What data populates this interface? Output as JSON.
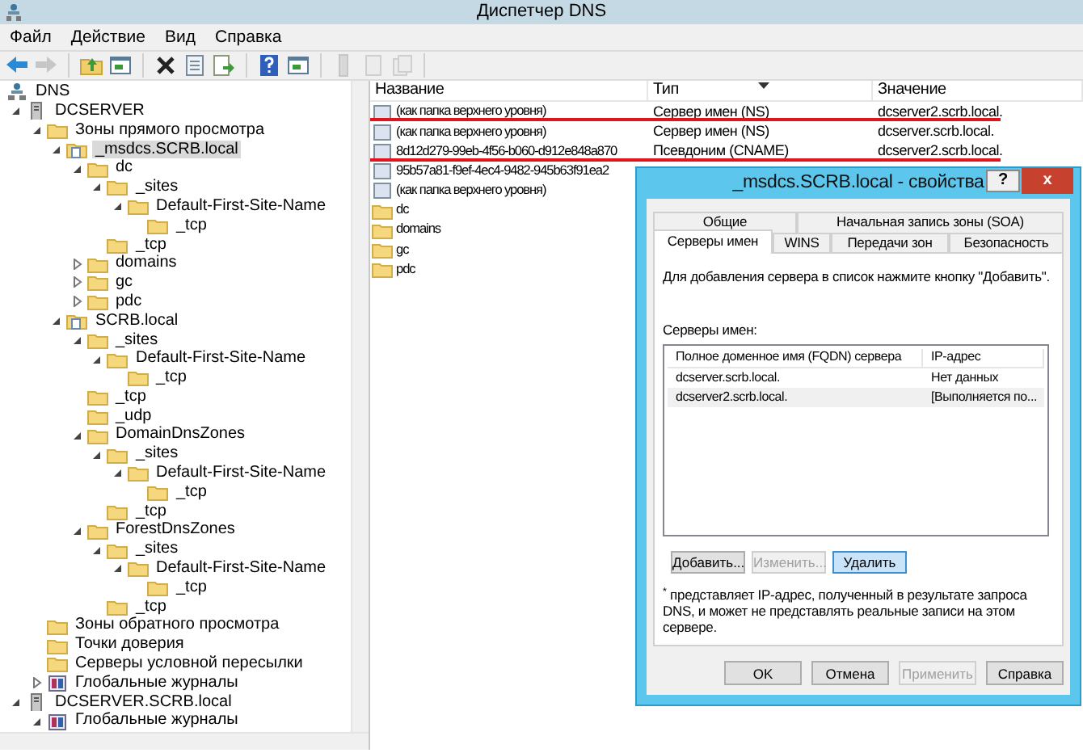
{
  "window": {
    "title": "Диспетчер DNS"
  },
  "menu": [
    "Файл",
    "Действие",
    "Вид",
    "Справка"
  ],
  "toolbar_groups": [
    {
      "buttons": [
        {
          "kind": "back",
          "disabled": false
        },
        {
          "kind": "forward",
          "disabled": true
        }
      ]
    },
    {
      "buttons": [
        {
          "kind": "up",
          "disabled": false
        },
        {
          "kind": "console",
          "disabled": false
        }
      ]
    },
    {
      "buttons": [
        {
          "kind": "delete",
          "disabled": false
        },
        {
          "kind": "properties",
          "disabled": false
        },
        {
          "kind": "export",
          "disabled": false
        }
      ]
    },
    {
      "buttons": [
        {
          "kind": "help",
          "disabled": false
        },
        {
          "kind": "console",
          "disabled": false
        }
      ]
    },
    {
      "buttons": [
        {
          "kind": "server",
          "disabled": true
        },
        {
          "kind": "page",
          "disabled": true
        },
        {
          "kind": "pages",
          "disabled": true
        }
      ]
    }
  ],
  "tree": [
    {
      "label": "DNS",
      "kind": "network",
      "selected": false,
      "children": [
        {
          "label": "DCSERVER",
          "kind": "server",
          "expanded": true,
          "selected": false,
          "children": [
            {
              "label": "Зоны прямого просмотра",
              "kind": "folder",
              "expanded": true,
              "selected": false,
              "children": [
                {
                  "label": "_msdcs.SCRB.local",
                  "kind": "zone",
                  "expanded": true,
                  "selected": true,
                  "children": [
                    {
                      "label": "dc",
                      "kind": "folder",
                      "expanded": true,
                      "selected": false,
                      "children": [
                        {
                          "label": "_sites",
                          "kind": "folder",
                          "expanded": true,
                          "selected": false,
                          "children": [
                            {
                              "label": "Default-First-Site-Name",
                              "kind": "folder",
                              "expanded": true,
                              "selected": false,
                              "children": [
                                {
                                  "label": "_tcp",
                                  "kind": "folder",
                                  "selected": false
                                }
                              ]
                            }
                          ]
                        },
                        {
                          "label": "_tcp",
                          "kind": "folder",
                          "selected": false
                        }
                      ]
                    },
                    {
                      "label": "domains",
                      "kind": "folder",
                      "expanded": false,
                      "selected": false
                    },
                    {
                      "label": "gc",
                      "kind": "folder",
                      "expanded": false,
                      "selected": false
                    },
                    {
                      "label": "pdc",
                      "kind": "folder",
                      "expanded": false,
                      "selected": false
                    }
                  ]
                },
                {
                  "label": "SCRB.local",
                  "kind": "zone",
                  "expanded": true,
                  "selected": false,
                  "children": [
                    {
                      "label": "_sites",
                      "kind": "folder",
                      "expanded": true,
                      "selected": false,
                      "children": [
                        {
                          "label": "Default-First-Site-Name",
                          "kind": "folder",
                          "expanded": true,
                          "selected": false,
                          "children": [
                            {
                              "label": "_tcp",
                              "kind": "folder",
                              "selected": false
                            }
                          ]
                        }
                      ]
                    },
                    {
                      "label": "_tcp",
                      "kind": "folder",
                      "selected": false
                    },
                    {
                      "label": "_udp",
                      "kind": "folder",
                      "selected": false
                    },
                    {
                      "label": "DomainDnsZones",
                      "kind": "folder",
                      "expanded": true,
                      "selected": false,
                      "children": [
                        {
                          "label": "_sites",
                          "kind": "folder",
                          "expanded": true,
                          "selected": false,
                          "children": [
                            {
                              "label": "Default-First-Site-Name",
                              "kind": "folder",
                              "expanded": true,
                              "selected": false,
                              "children": [
                                {
                                  "label": "_tcp",
                                  "kind": "folder",
                                  "selected": false
                                }
                              ]
                            }
                          ]
                        },
                        {
                          "label": "_tcp",
                          "kind": "folder",
                          "selected": false
                        }
                      ]
                    },
                    {
                      "label": "ForestDnsZones",
                      "kind": "folder",
                      "expanded": true,
                      "selected": false,
                      "children": [
                        {
                          "label": "_sites",
                          "kind": "folder",
                          "expanded": true,
                          "selected": false,
                          "children": [
                            {
                              "label": "Default-First-Site-Name",
                              "kind": "folder",
                              "expanded": true,
                              "selected": false,
                              "children": [
                                {
                                  "label": "_tcp",
                                  "kind": "folder",
                                  "selected": false
                                }
                              ]
                            }
                          ]
                        },
                        {
                          "label": "_tcp",
                          "kind": "folder",
                          "selected": false
                        }
                      ]
                    }
                  ]
                }
              ]
            },
            {
              "label": "Зоны обратного просмотра",
              "kind": "folder",
              "selected": false
            },
            {
              "label": "Точки доверия",
              "kind": "folder",
              "selected": false
            },
            {
              "label": "Серверы условной пересылки",
              "kind": "folder",
              "selected": false
            },
            {
              "label": "Глобальные журналы",
              "kind": "log",
              "expanded": false,
              "selected": false
            }
          ]
        },
        {
          "label": "DCSERVER.SCRB.local",
          "kind": "server",
          "expanded": true,
          "selected": false,
          "children": [
            {
              "label": "Глобальные журналы",
              "kind": "log",
              "expanded": true,
              "selected": false
            }
          ]
        }
      ]
    }
  ],
  "list": {
    "columns": [
      {
        "label": "Название",
        "sorted": false
      },
      {
        "label": "Тип",
        "sorted": true
      },
      {
        "label": "Значение",
        "sorted": false
      }
    ],
    "rows": [
      {
        "kind": "record",
        "name": "(как папка верхнего уровня)",
        "type": "Сервер имен (NS)",
        "value": "dcserver2.scrb.local.",
        "underlined": true
      },
      {
        "kind": "record",
        "name": "(как папка верхнего уровня)",
        "type": "Сервер имен (NS)",
        "value": "dcserver.scrb.local.",
        "underlined": false
      },
      {
        "kind": "record",
        "name": "8d12d279-99eb-4f56-b060-d912e848a870",
        "type": "Псевдоним (CNAME)",
        "value": "dcserver2.scrb.local.",
        "underlined": true
      },
      {
        "kind": "record",
        "name": "95b57a81-f9ef-4ec4-9482-945b63f91ea2",
        "underlined": false
      },
      {
        "kind": "record",
        "name": "(как папка верхнего уровня)",
        "underlined": false
      },
      {
        "kind": "folder",
        "name": "dc",
        "underlined": false
      },
      {
        "kind": "folder",
        "name": "domains",
        "underlined": false
      },
      {
        "kind": "folder",
        "name": "gc",
        "underlined": false
      },
      {
        "kind": "folder",
        "name": "pdc",
        "underlined": false
      }
    ]
  },
  "dialog": {
    "title": "_msdcs.SCRB.local - свойства",
    "help_button": "?",
    "close_button": "x",
    "tab_rows": [
      [
        {
          "label": "Общие",
          "selected": false
        },
        {
          "label": "Начальная запись зоны (SOA)",
          "selected": false
        }
      ],
      [
        {
          "label": "Серверы имен",
          "selected": true
        },
        {
          "label": "WINS",
          "selected": false
        },
        {
          "label": "Передачи зон",
          "selected": false
        },
        {
          "label": "Безопасность",
          "selected": false
        }
      ]
    ],
    "intro": "Для добавления сервера в список нажмите кнопку \"Добавить\".",
    "servers_label": "Серверы имен:",
    "columns": [
      "Полное доменное имя (FQDN) сервера",
      "IP-адрес"
    ],
    "servers": [
      {
        "fqdn": "dcserver.scrb.local.",
        "ip": "Нет данных",
        "selected": false
      },
      {
        "fqdn": "dcserver2.scrb.local.",
        "ip": "[Выполняется по...",
        "selected": true
      }
    ],
    "buttons": [
      {
        "label": "Добавить...",
        "disabled": false,
        "focused": false
      },
      {
        "label": "Изменить...",
        "disabled": true,
        "focused": false
      },
      {
        "label": "Удалить",
        "disabled": false,
        "focused": true
      }
    ],
    "footnote": "$^{*}$ представляет IP-адрес, полученный в результате запроса DNS, и может не представлять реальные записи на этом сервере.",
    "footer_buttons": [
      {
        "label": "OK",
        "disabled": false
      },
      {
        "label": "Отмена",
        "disabled": false
      },
      {
        "label": "Применить",
        "disabled": true
      },
      {
        "label": "Справка",
        "disabled": false
      }
    ]
  }
}
